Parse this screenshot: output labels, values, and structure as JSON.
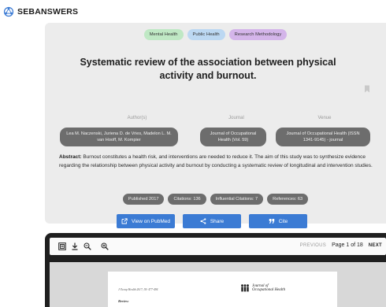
{
  "brand": {
    "name": "SEBANSWERS",
    "icon": "network-logo-icon"
  },
  "paper": {
    "tags": [
      "Mental Health",
      "Public Health",
      "Research Methodology"
    ],
    "title": "Systematic review of the association between physical activity and burnout.",
    "meta": {
      "authors_label": "Author(s)",
      "authors": "Lea M. Naczenski, Juriena D. de Vries, Madelon L. M. van Hooff, M. Kompier",
      "journal_label": "Journal",
      "journal": "Journal of Occupational Health (Vol. 59)",
      "venue_label": "Venue",
      "venue": "Journal of Occupational Health (ISSN 1341-9145) - journal"
    },
    "abstract_label": "Abstract:",
    "abstract": "Burnout constitutes a health risk, and interventions are needed to reduce it. The aim of this study was to synthesize evidence regarding the relationship between physical activity and burnout by conducting a systematic review of longitudinal and intervention studies.",
    "stats": [
      "Published 2017",
      "Citations: 136",
      "Influential Citations: 7",
      "References: 63"
    ],
    "actions": {
      "pubmed": "View on PubMed",
      "share": "Share",
      "cite": "Cite"
    }
  },
  "viewer": {
    "prev": "PREVIOUS",
    "page_info": "Page 1 of 18",
    "next": "NEXT",
    "pdf": {
      "citation": "J Occup Health 2017; 59: 477-494",
      "section": "Review",
      "journal_logo_line1": "Journal of",
      "journal_logo_line2": "Occupational Health"
    }
  },
  "colors": {
    "accent": "#3b7bd4",
    "card_bg": "#ececec",
    "pill_dark": "#6d6d6d",
    "tag_mental": "#bfe8c4",
    "tag_public": "#bcd8f2",
    "tag_method": "#d4b5ea",
    "viewer_bg": "#1f1f1f"
  }
}
